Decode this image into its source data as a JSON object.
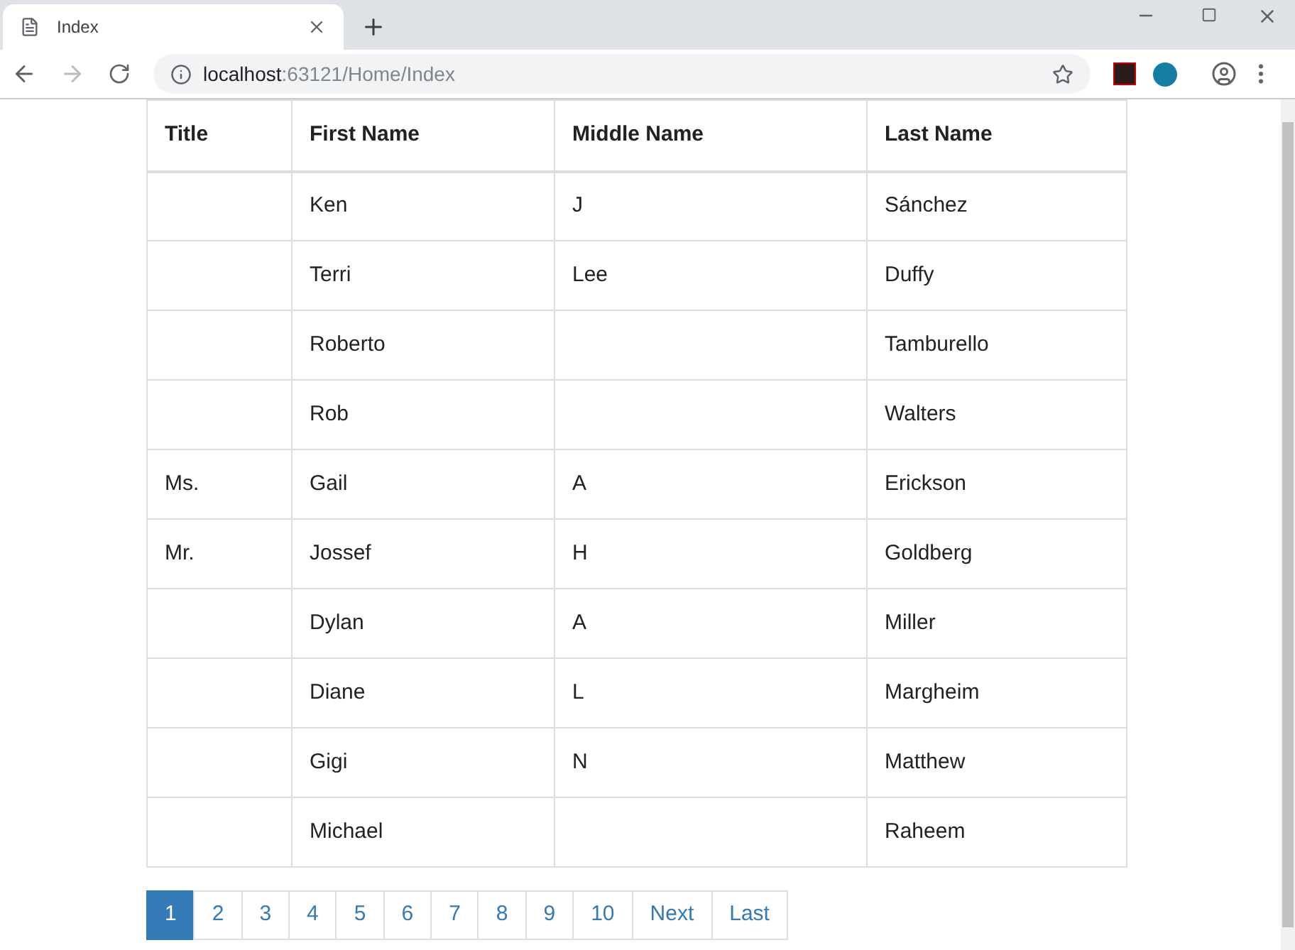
{
  "browser": {
    "tab": {
      "title": "Index"
    },
    "address": {
      "host": "localhost",
      "path": ":63121/Home/Index"
    }
  },
  "table": {
    "columns": [
      "Title",
      "First Name",
      "Middle Name",
      "Last Name"
    ],
    "rows": [
      [
        "",
        "Ken",
        "J",
        "Sánchez"
      ],
      [
        "",
        "Terri",
        "Lee",
        "Duffy"
      ],
      [
        "",
        "Roberto",
        "",
        "Tamburello"
      ],
      [
        "",
        "Rob",
        "",
        "Walters"
      ],
      [
        "Ms.",
        "Gail",
        "A",
        "Erickson"
      ],
      [
        "Mr.",
        "Jossef",
        "H",
        "Goldberg"
      ],
      [
        "",
        "Dylan",
        "A",
        "Miller"
      ],
      [
        "",
        "Diane",
        "L",
        "Margheim"
      ],
      [
        "",
        "Gigi",
        "N",
        "Matthew"
      ],
      [
        "",
        "Michael",
        "",
        "Raheem"
      ]
    ]
  },
  "pagination": [
    {
      "label": "1",
      "selected": true
    },
    {
      "label": "2",
      "selected": false
    },
    {
      "label": "3",
      "selected": false
    },
    {
      "label": "4",
      "selected": false
    },
    {
      "label": "5",
      "selected": false
    },
    {
      "label": "6",
      "selected": false
    },
    {
      "label": "7",
      "selected": false
    },
    {
      "label": "8",
      "selected": false
    },
    {
      "label": "9",
      "selected": false
    },
    {
      "label": "10",
      "selected": false
    },
    {
      "label": "Next",
      "selected": false
    },
    {
      "label": "Last",
      "selected": false
    }
  ]
}
